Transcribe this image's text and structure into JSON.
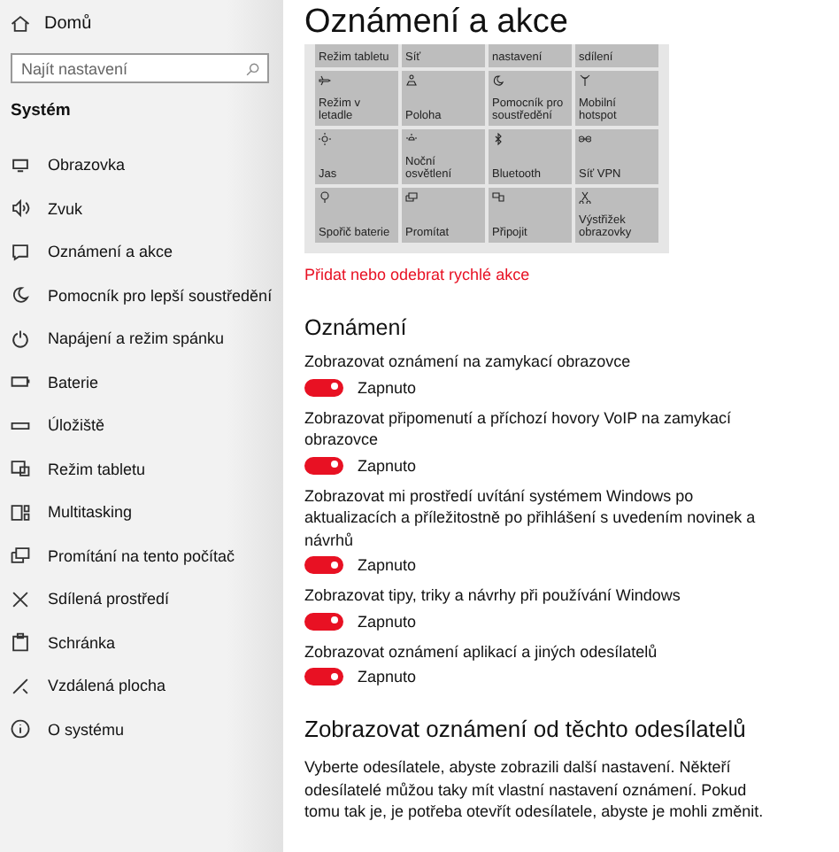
{
  "sidebar": {
    "home": "Domů",
    "search": {
      "placeholder": "Najít nastavení"
    },
    "section": "Systém",
    "items": [
      {
        "label": "Obrazovka",
        "selected": false
      },
      {
        "label": "Zvuk",
        "selected": false
      },
      {
        "label": "Oznámení a akce",
        "selected": false
      },
      {
        "label": "Pomocník pro lepší soustředění",
        "selected": false
      },
      {
        "label": "Napájení a režim spánku",
        "selected": false
      },
      {
        "label": "Baterie",
        "selected": false
      },
      {
        "label": "Úložiště",
        "selected": false
      },
      {
        "label": "Režim tabletu",
        "selected": false
      },
      {
        "label": "Multitasking",
        "selected": false
      },
      {
        "label": "Promítání na tento počítač",
        "selected": false
      },
      {
        "label": "Sdílená prostředí",
        "selected": false
      },
      {
        "label": "Schránka",
        "selected": false
      },
      {
        "label": "Vzdálená plocha",
        "selected": false
      },
      {
        "label": "O systému",
        "selected": false
      }
    ]
  },
  "page_title": "Oznámení a akce",
  "quick_actions": {
    "cut_row": [
      "Režim tabletu",
      "Síť",
      "nastavení",
      "sdílení"
    ],
    "tiles": [
      "Režim v letadle",
      "Poloha",
      "Pomocník pro soustředění",
      "Mobilní hotspot",
      "Jas",
      "Noční osvětlení",
      "Bluetooth",
      "Síť VPN",
      "Spořič baterie",
      "Promítat",
      "Připojit",
      "Výstřižek obrazovky"
    ],
    "link": "Přidat nebo odebrat rychlé akce"
  },
  "notifications": {
    "heading": "Oznámení",
    "settings": [
      {
        "label": "Zobrazovat oznámení na zamykací obrazovce",
        "on": true,
        "state": "Zapnuto"
      },
      {
        "label": "Zobrazovat připomenutí a příchozí hovory VoIP na zamykací obrazovce",
        "on": true,
        "state": "Zapnuto"
      },
      {
        "label": "Zobrazovat mi prostředí uvítání systémem Windows po aktualizacích a příležitostně po přihlášení s uvedením novinek a návrhů",
        "on": true,
        "state": "Zapnuto"
      },
      {
        "label": "Zobrazovat tipy, triky a návrhy při používání Windows",
        "on": true,
        "state": "Zapnuto"
      },
      {
        "label": "Zobrazovat oznámení aplikací a jiných odesílatelů",
        "on": true,
        "state": "Zapnuto"
      }
    ]
  },
  "senders": {
    "heading": "Zobrazovat oznámení od těchto odesílatelů",
    "text": "Vyberte odesílatele, abyste zobrazili další nastavení. Někteří odesílatelé můžou taky mít vlastní nastavení oznámení. Pokud tomu tak je, je potřeba otevřít odesílatele, abyste je mohli změnit."
  }
}
